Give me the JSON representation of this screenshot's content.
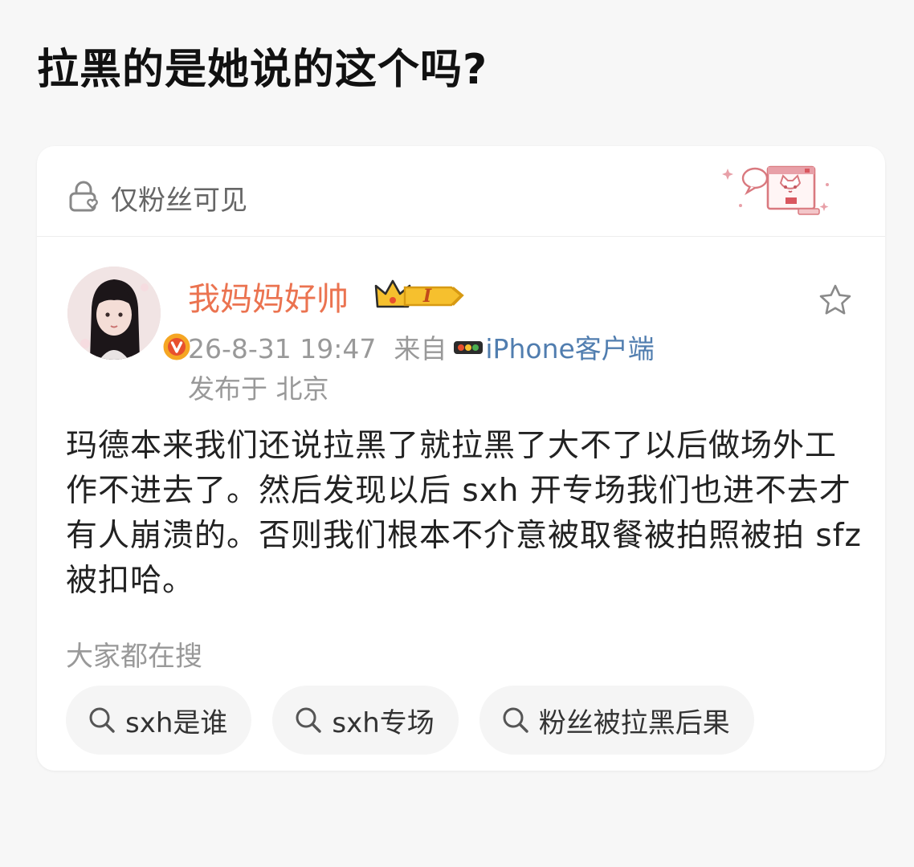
{
  "page": {
    "title": "拉黑的是她说的这个吗?"
  },
  "card": {
    "visibility_label": "仅粉丝可见",
    "visibility_icon": "lock-icon",
    "sticker_icon": "cat-sticker-icon"
  },
  "post": {
    "username": "我妈妈好帅",
    "username_color": "#eb7350",
    "member_badge_text": "I",
    "avatar_icon": "user-avatar",
    "verified_icon": "verified-v-icon",
    "time": "26-8-31 19:47",
    "from_label": "来自",
    "device": "iPhone客户端",
    "location": "发布于 北京",
    "body": "玛德本来我们还说拉黑了就拉黑了大不了以后做场外工作不进去了。然后发现以后 sxh 开专场我们也进不去才有人崩溃的。否则我们根本不介意被取餐被拍照被拍 sfz 被扣哈。",
    "favorite_icon": "star-icon"
  },
  "search": {
    "heading": "大家都在搜",
    "chips": [
      {
        "label": "sxh是谁",
        "icon": "search-icon"
      },
      {
        "label": "sxh专场",
        "icon": "search-icon"
      },
      {
        "label": "粉丝被拉黑后果",
        "icon": "search-icon"
      }
    ]
  },
  "colors": {
    "accent_orange": "#eb7350",
    "link_blue": "#507daf",
    "muted_gray": "#999999"
  }
}
